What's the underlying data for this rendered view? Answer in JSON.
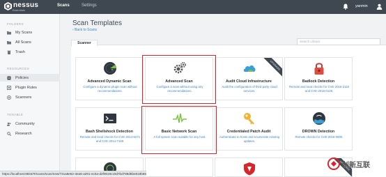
{
  "topbar": {
    "brand": "nessus",
    "brand_sub": "Essentials",
    "nav": [
      "Scans",
      "Settings"
    ],
    "user": "yanmin"
  },
  "sidebar": {
    "sections": [
      {
        "title": "FOLDERS",
        "items": [
          "My Scans",
          "All Scans",
          "Trash"
        ]
      },
      {
        "title": "RESOURCES",
        "items": [
          "Policies",
          "Plugin Rules",
          "Scanners"
        ]
      },
      {
        "title": "TENABLE",
        "items": [
          "Community",
          "Research"
        ]
      }
    ]
  },
  "main": {
    "title": "Scan Templates",
    "back": "‹ Back to Scans",
    "tab": "Scanner",
    "search_placeholder": "Search Library"
  },
  "cards": [
    {
      "title": "Advanced Dynamic Scan",
      "desc": "Configure a dynamic plugin scan without recommendations.",
      "icon": "radar-icon",
      "ribbon": ""
    },
    {
      "title": "Advanced Scan",
      "desc": "Configure a scan without using any recommendations.",
      "icon": "gears-icon",
      "ribbon": ""
    },
    {
      "title": "Audit Cloud Infrastructure",
      "desc": "Audit the configuration of third-party cloud services.",
      "icon": "cloud-icon",
      "ribbon": "UPGRADE"
    },
    {
      "title": "Badlock Detection",
      "desc": "Remote and local checks for CVE-2016-2118 and CVE-2016-0128.",
      "icon": "padlock-icon",
      "ribbon": ""
    },
    {
      "title": "Bash Shellshock Detection",
      "desc": "Remote and local checks for CVE-2014-6271 and CVE-2014-7169.",
      "icon": "terminal-icon",
      "ribbon": ""
    },
    {
      "title": "Basic Network Scan",
      "desc": "A full system scan suitable for any host.",
      "icon": "pulse-icon",
      "ribbon": ""
    },
    {
      "title": "Credentialed Patch Audit",
      "desc": "Authenticate to hosts and enumerate missing updates.",
      "icon": "key-icon",
      "ribbon": ""
    },
    {
      "title": "DROWN Detection",
      "desc": "Remote checks for CVE-2016-0800.",
      "icon": "drown-icon",
      "ribbon": ""
    }
  ],
  "status_url": "https://localhost:8834/#/scans/scan/new/731a8e52-3ea6-a291-ec0a-d2f0619c19d7bd788d6be818b65",
  "watermark": {
    "text": "创新互联",
    "sub": "CHUANGXIN HULIAN"
  }
}
